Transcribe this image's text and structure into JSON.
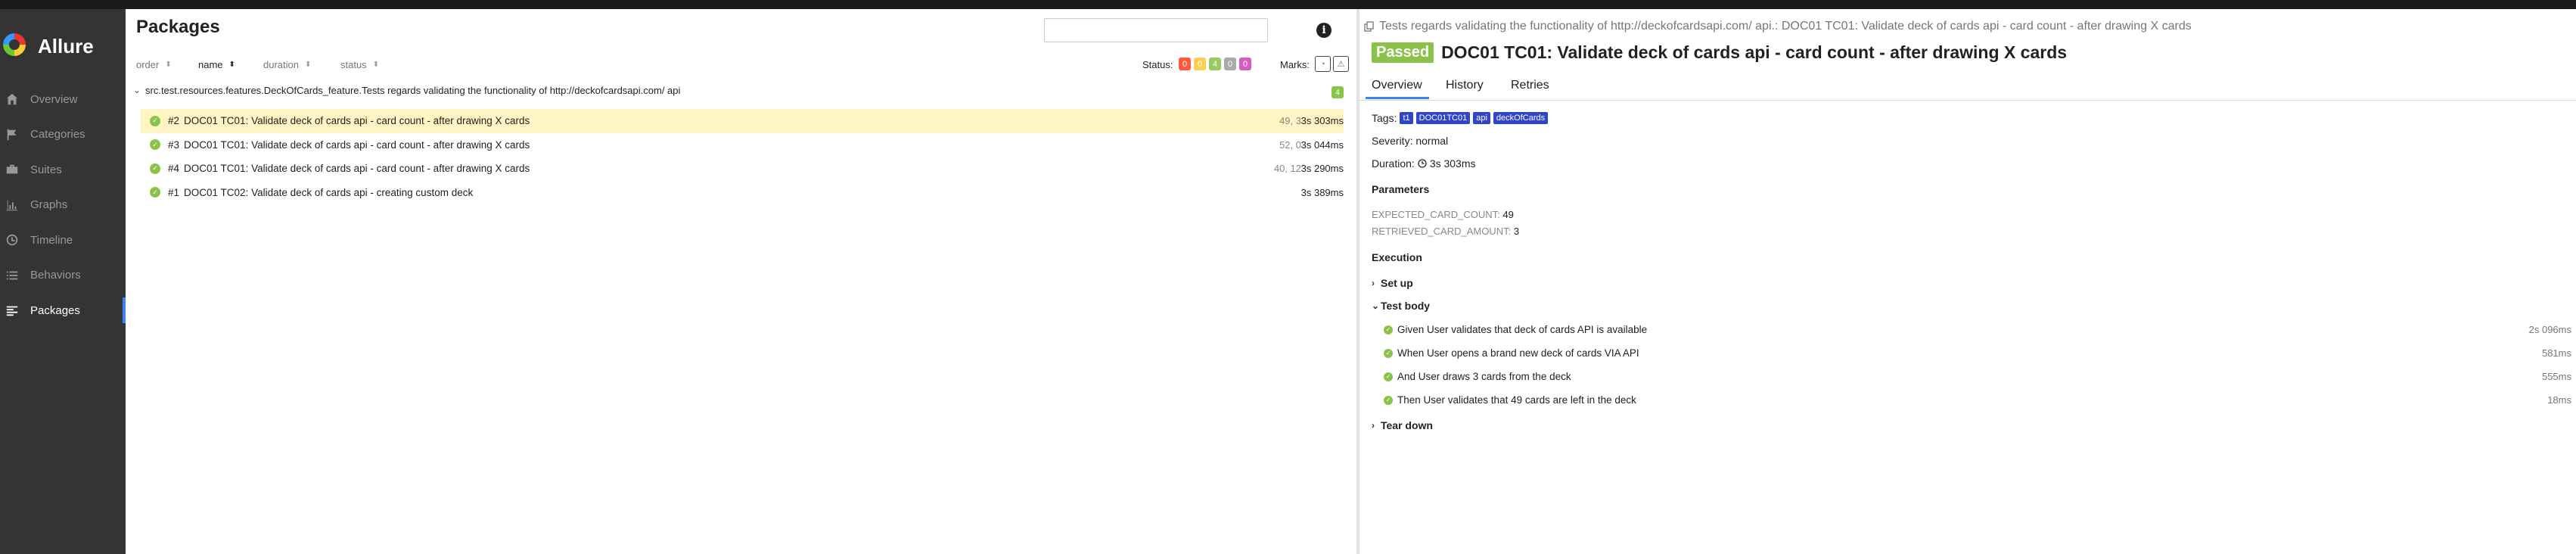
{
  "app": {
    "brand": "Allure"
  },
  "sidebar": {
    "items": [
      {
        "label": "Overview",
        "icon": "home-icon"
      },
      {
        "label": "Categories",
        "icon": "flag-icon"
      },
      {
        "label": "Suites",
        "icon": "briefcase-icon"
      },
      {
        "label": "Graphs",
        "icon": "bar-chart-icon"
      },
      {
        "label": "Timeline",
        "icon": "clock-icon"
      },
      {
        "label": "Behaviors",
        "icon": "list-icon"
      },
      {
        "label": "Packages",
        "icon": "align-left-icon",
        "active": true
      }
    ]
  },
  "packages": {
    "title": "Packages",
    "search": {
      "value": "",
      "placeholder": ""
    },
    "sort": {
      "order": "order",
      "name": "name",
      "duration": "duration",
      "status": "status"
    },
    "status_label": "Status:",
    "status_counts": [
      {
        "value": "0",
        "color": "#fd5a3e"
      },
      {
        "value": "0",
        "color": "#ffd050"
      },
      {
        "value": "4",
        "color": "#97cc64"
      },
      {
        "value": "0",
        "color": "#aaaaaa"
      },
      {
        "value": "0",
        "color": "#d35ebe"
      }
    ],
    "marks_label": "Marks:",
    "group": {
      "label": "src.test.resources.features.DeckOfCards_feature.Tests regards validating the functionality of http://deckofcardsapi.com/ api",
      "count": "4"
    },
    "rows": [
      {
        "num": "#2",
        "name": "DOC01 TC01: Validate deck of cards api - card count - after drawing X cards",
        "params": "49, 3",
        "duration": "3s 303ms",
        "selected": true
      },
      {
        "num": "#3",
        "name": "DOC01 TC01: Validate deck of cards api - card count - after drawing X cards",
        "params": "52, 0",
        "duration": "3s 044ms",
        "selected": false
      },
      {
        "num": "#4",
        "name": "DOC01 TC01: Validate deck of cards api - card count - after drawing X cards",
        "params": "40, 12",
        "duration": "3s 290ms",
        "selected": false
      },
      {
        "num": "#1",
        "name": "DOC01 TC02: Validate deck of cards api - creating custom deck",
        "params": "",
        "duration": "3s 389ms",
        "selected": false
      }
    ]
  },
  "detail": {
    "breadcrumb": "Tests regards validating the functionality of http://deckofcardsapi.com/ api.: DOC01 TC01: Validate deck of cards api - card count - after drawing X cards",
    "status": "Passed",
    "title": "DOC01 TC01: Validate deck of cards api - card count - after drawing X cards",
    "tabs": [
      "Overview",
      "History",
      "Retries"
    ],
    "tags_label": "Tags:",
    "tags": [
      "t1",
      "DOC01TC01",
      "api",
      "deckOfCards"
    ],
    "severity": "Severity: normal",
    "duration_label": "Duration:",
    "duration": "3s 303ms",
    "parameters_heading": "Parameters",
    "parameters": [
      {
        "name": "EXPECTED_CARD_COUNT:",
        "value": "49"
      },
      {
        "name": "RETRIEVED_CARD_AMOUNT:",
        "value": "3"
      }
    ],
    "execution_heading": "Execution",
    "setup": "Set up",
    "test_body": "Test body",
    "teardown": "Tear down",
    "steps": [
      {
        "text": "Given User validates that deck of cards API is available",
        "duration": "2s 096ms"
      },
      {
        "text": "When User opens a brand new deck of cards VIA API",
        "duration": "581ms"
      },
      {
        "text": "And User draws 3 cards from the deck",
        "duration": "555ms"
      },
      {
        "text": "Then User validates that 49 cards are left in the deck",
        "duration": "18ms"
      }
    ]
  }
}
